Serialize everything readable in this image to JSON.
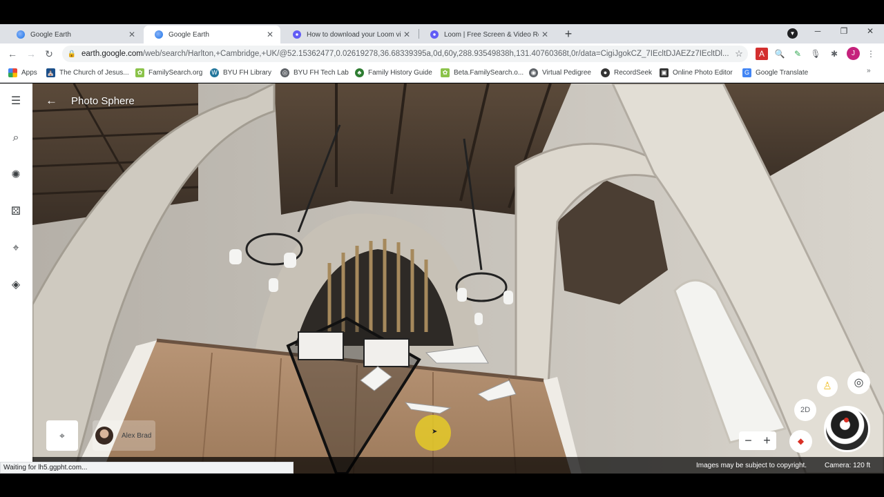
{
  "tabs": [
    {
      "title": "Google Earth",
      "favicon": "google-earth-icon",
      "active": false
    },
    {
      "title": "Google Earth",
      "favicon": "google-earth-icon",
      "active": true
    },
    {
      "title": "How to download your Loom vid",
      "favicon": "loom-icon",
      "active": false
    },
    {
      "title": "Loom | Free Screen & Video Reco",
      "favicon": "loom-icon",
      "active": false
    }
  ],
  "address_bar": {
    "url_host": "earth.google.com",
    "url_path": "/web/search/Harlton,+Cambridge,+UK/@52.15362477,0.02619278,36.68339395a,0d,60y,288.93549838h,131.40760368t,0r/data=CigiJgokCZ_7IEcltDJAEZz7IEcltDl..."
  },
  "bookmarks": [
    {
      "label": "Apps",
      "icon": "apps-grid-icon",
      "color": "#ea4335"
    },
    {
      "label": "The Church of Jesus...",
      "icon": "church-icon",
      "color": "#1a4f8b"
    },
    {
      "label": "FamilySearch.org",
      "icon": "familysearch-tree-icon",
      "color": "#8bc34a"
    },
    {
      "label": "BYU FH Library",
      "icon": "wordpress-icon",
      "color": "#21759b"
    },
    {
      "label": "BYU FH Tech Lab",
      "icon": "techlab-icon",
      "color": "#5f6368"
    },
    {
      "label": "Family History Guide",
      "icon": "tree-icon",
      "color": "#2e7d32"
    },
    {
      "label": "Beta.FamilySearch.o...",
      "icon": "familysearch-tree-icon",
      "color": "#8bc34a"
    },
    {
      "label": "Virtual Pedigree",
      "icon": "pedigree-icon",
      "color": "#5f6368"
    },
    {
      "label": "RecordSeek",
      "icon": "recordseek-icon",
      "color": "#333333"
    },
    {
      "label": "Online Photo Editor",
      "icon": "photo-editor-icon",
      "color": "#333333"
    },
    {
      "label": "Google Translate",
      "icon": "translate-icon",
      "color": "#4285f4"
    }
  ],
  "earth": {
    "title": "Photo Sphere",
    "author": "Alex Brad",
    "two_d_label": "2D",
    "zoom_out": "−",
    "zoom_in": "+",
    "copyright": "Images may be subject to copyright.",
    "camera": "Camera: 120 ft"
  },
  "status_text": "Waiting for lh5.ggpht.com...",
  "colors": {
    "accent": "#1a73e8",
    "cursor_highlight": "#e5ca28",
    "avatar": "#c5227c"
  }
}
